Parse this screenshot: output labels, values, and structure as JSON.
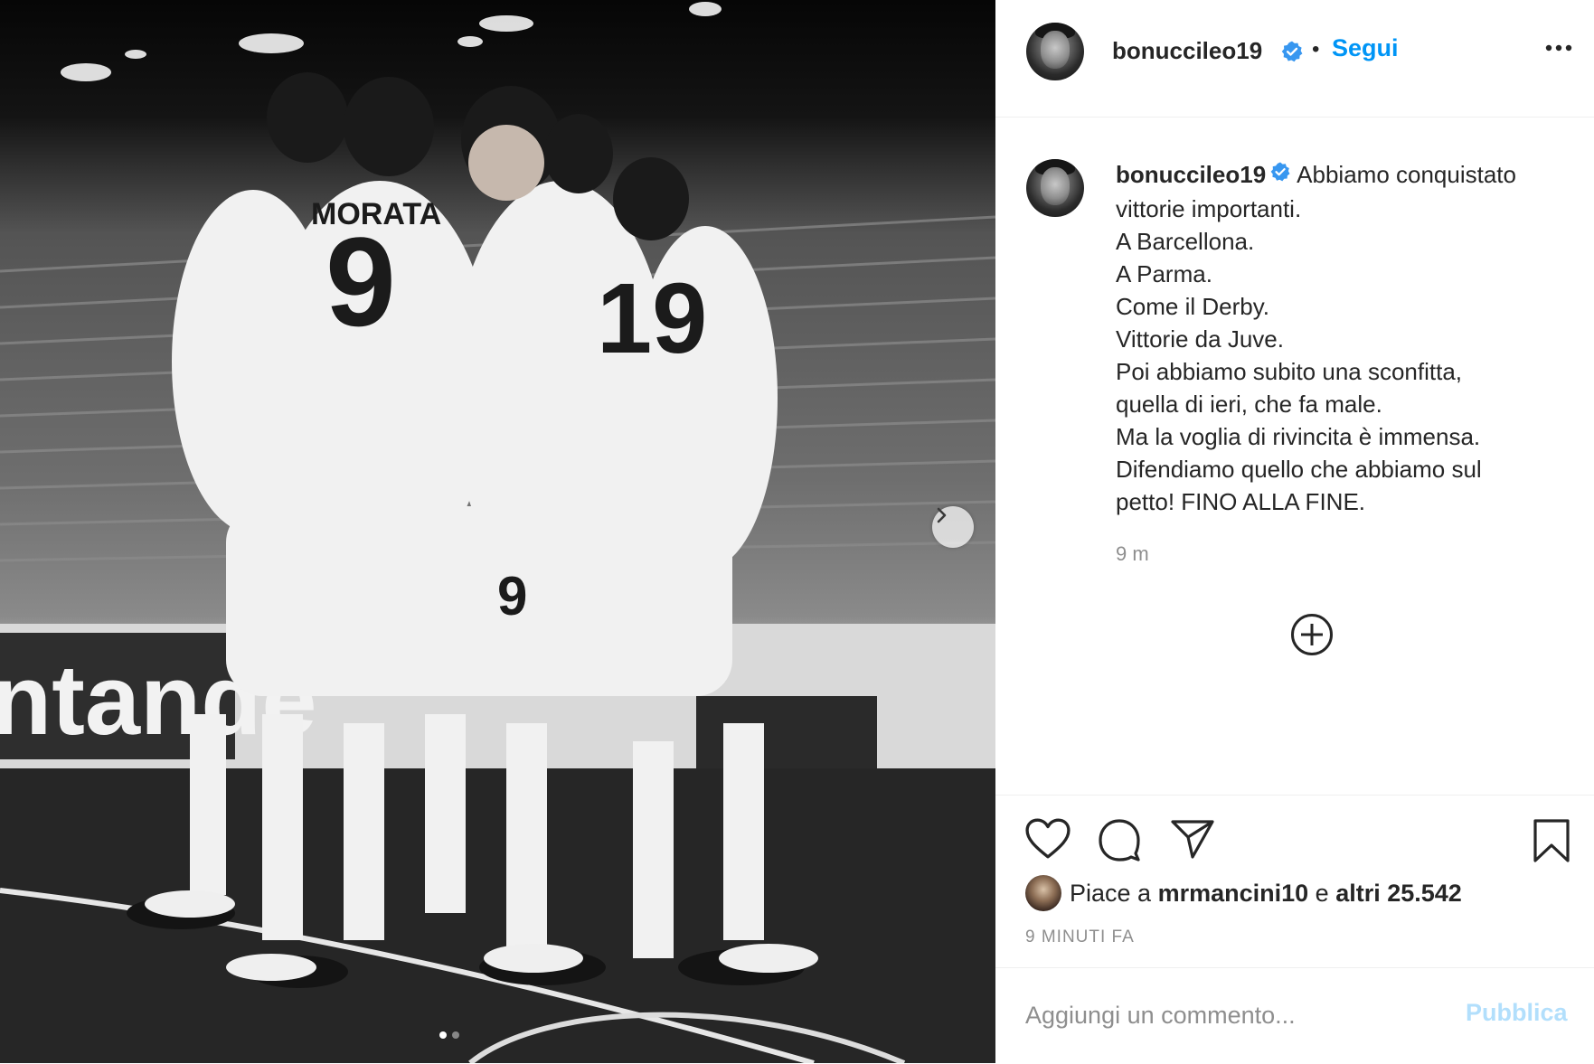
{
  "post": {
    "username": "bonuccileo19",
    "verified_icon": "verified-badge-icon",
    "follow_separator": "•",
    "follow_label": "Segui",
    "more_icon": "more-options-icon"
  },
  "image": {
    "description_icon": "team-celebration-photo",
    "carousel_current": 1,
    "carousel_total": 2
  },
  "caption": {
    "username": "bonuccileo19",
    "lines": [
      "Abbiamo conquistato",
      "vittorie importanti.",
      "A Barcellona.",
      "A Parma.",
      "Come il Derby.",
      "Vittorie da Juve.",
      "Poi abbiamo subito una sconfitta,",
      "quella di ieri, che fa male.",
      "Ma la voglia di rivincita è immensa.",
      "Difendiamo quello che abbiamo sul",
      "petto! FINO ALLA FINE."
    ],
    "time_ago": "9 m"
  },
  "likes": {
    "prefix": "Piace a",
    "user": "mrmancini10",
    "conjunction": "e",
    "others": "altri 25.542"
  },
  "posted_ago": "9 MINUTI FA",
  "comment": {
    "placeholder": "Aggiungi un commento...",
    "publish_label": "Pubblica"
  },
  "colors": {
    "accent": "#0095f6",
    "publish_disabled": "#b2dffc",
    "text": "#262626",
    "muted": "#8e8e8e",
    "verified": "#3897f0"
  }
}
